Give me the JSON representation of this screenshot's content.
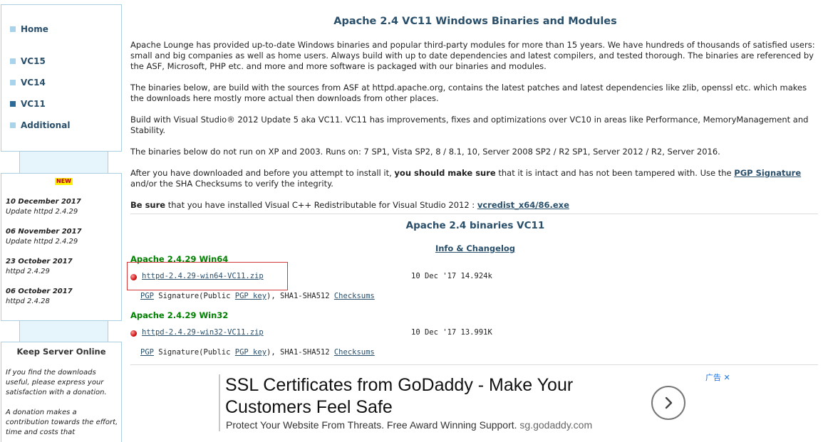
{
  "sidebar": {
    "nav": [
      {
        "label": "Home",
        "active": false
      },
      {
        "label": "VC15",
        "active": false
      },
      {
        "label": "VC14",
        "active": false
      },
      {
        "label": "VC11",
        "active": true
      },
      {
        "label": "Additional",
        "active": false
      }
    ],
    "news_badge": "NEW",
    "news": [
      {
        "date": "10 December 2017",
        "text": "Update httpd 2.4.29"
      },
      {
        "date": "06 November 2017",
        "text": "Update httpd 2.4.29"
      },
      {
        "date": "23 October 2017",
        "text": "httpd 2.4.29"
      },
      {
        "date": "06 October 2017",
        "text": "httpd 2.4.28"
      }
    ],
    "keep": {
      "title": "Keep Server Online",
      "p1": "If you find the downloads useful, please express your satisfaction with a donation.",
      "p2": "A donation makes a contribution towards the effort, time and costs that"
    }
  },
  "main": {
    "title": "Apache 2.4 VC11 Windows Binaries and Modules",
    "p1": "Apache Lounge has provided up-to-date Windows binaries and popular third-party modules for more than 15 years. We have hundreds of thousands of satisfied users: small and big companies as well as home users. Always build with up to date dependencies and latest compilers, and tested thorough. The binaries are referenced by the ASF, Microsoft, PHP etc. and more and more software is packaged with our binaries and modules.",
    "p2": "The binaries below, are build with the sources from ASF at httpd.apache.org, contains the latest patches and latest dependencies like zlib, openssl etc. which makes the downloads here mostly more actual then downloads from other places.",
    "p3": "Build with Visual Studio® 2012 Update 5 aka VC11. VC11 has improvements, fixes and optimizations over VC10 in areas like Performance, MemoryManagement and Stability.",
    "p4": "The binaries below do not run on XP and 2003. Runs on: 7 SP1, Vista SP2, 8 / 8.1, 10, Server 2008 SP2 / R2 SP1, Server 2012 / R2, Server 2016.",
    "p5": {
      "a": "After you have downloaded and before you attempt to install it, ",
      "b": "you should make sure",
      "c": " that it is intact and has not been tampered with. Use the ",
      "link": "PGP Signature",
      "d": " and/or the SHA Checksums to verify the integrity."
    },
    "p6": {
      "bold": "Be sure",
      "text": " that you have installed Visual C++ Redistributable for Visual Studio 2012 : ",
      "link": "vcredist_x64/86.exe"
    },
    "subtitle": "Apache 2.4 binaries VC11",
    "info_link": "Info & Changelog",
    "downloads": [
      {
        "heading": "Apache 2.4.29 Win64",
        "file": "httpd-2.4.29-win64-VC11.zip",
        "meta": "10 Dec '17 14.924k",
        "pgp": "PGP",
        "sig_text": " Signature(Public ",
        "pgp_key": "PGP key",
        "sha_text": "), SHA1-SHA512 ",
        "checksums": "Checksums"
      },
      {
        "heading": "Apache 2.4.29 Win32",
        "file": "httpd-2.4.29-win32-VC11.zip",
        "meta": "10 Dec '17 13.991K",
        "pgp": "PGP",
        "sig_text": " Signature(Public ",
        "pgp_key": "PGP key",
        "sha_text": "), SHA1-SHA512 ",
        "checksums": "Checksums"
      }
    ]
  },
  "ad": {
    "headline": "SSL Certificates from GoDaddy - Make Your Customers Feel Safe",
    "description": "Protect Your Website From Threats. Free Award Winning Support.",
    "domain": "sg.godaddy.com",
    "ad_label": "广告",
    "close": "✕",
    "arrow_icon": "chevron-right-icon"
  },
  "colors": {
    "heading": "#2a4f6b",
    "green": "#008000",
    "sidebar_border": "#a9cfe0",
    "highlight": "#d23a3a"
  }
}
